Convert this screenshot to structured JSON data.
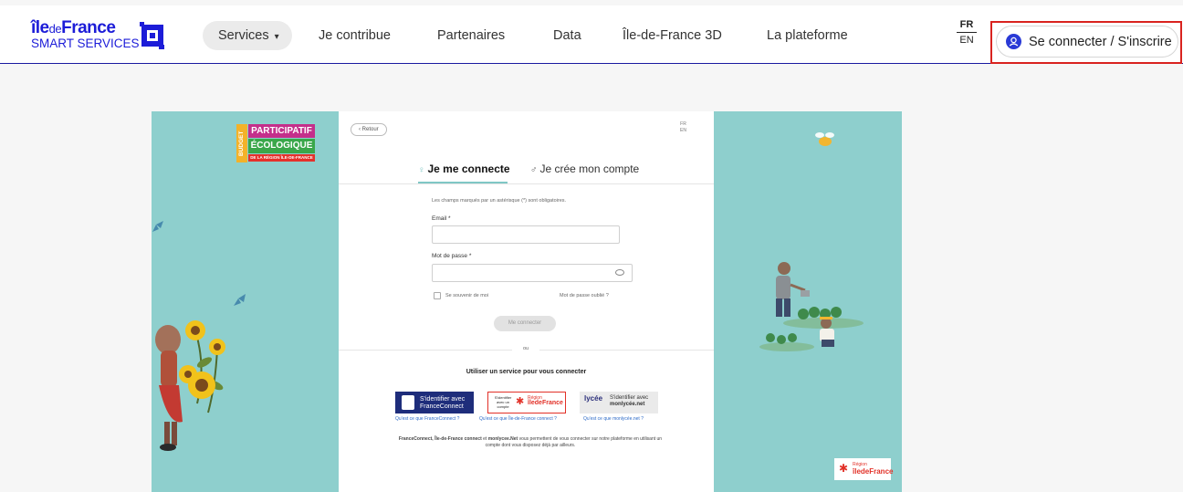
{
  "header": {
    "logo": {
      "line1_ile": "île",
      "line1_de": "de",
      "line1_france": "France",
      "line2": "SMART SERVICES"
    },
    "nav": [
      {
        "label": "Services",
        "active": true,
        "has_dropdown": true
      },
      {
        "label": "Je contribue"
      },
      {
        "label": "Partenaires"
      },
      {
        "label": "Data"
      },
      {
        "label": "Île-de-France 3D"
      },
      {
        "label": "La plateforme"
      }
    ],
    "dropdown_caret": "▾",
    "lang": {
      "current": "FR",
      "other": "EN"
    },
    "login_button": "Se connecter / S'inscrire",
    "login_icon": "user-circle-icon",
    "highlight_color": "#d9231f"
  },
  "embedded": {
    "budget_logo": {
      "vertical": "BUDGET",
      "line1": "PARTICIPATIF",
      "line2": "ÉCOLOGIQUE",
      "line3": "DE LA RÉGION ÎLE-DE-FRANCE"
    },
    "back_button": "‹ Retour",
    "lang": {
      "current": "FR",
      "other": "EN"
    },
    "tabs": {
      "login": "Je me connecte",
      "signup": "Je crée mon compte"
    },
    "required_note": "Les champs marqués par un astérisque (*) sont obligatoires.",
    "email_label": "Email *",
    "password_label": "Mot de passe *",
    "remember_me": "Se souvenir de moi",
    "forgot_password": "Mot de passe oublié ?",
    "submit": "Me connecter",
    "separator": "ou",
    "services_title": "Utiliser un service pour vous connecter",
    "franceconnect": {
      "line1": "S'identifier avec",
      "line2": "FranceConnect",
      "help": "Qu'est ce que FranceConnect ?"
    },
    "idf_connect": {
      "left": "S'identifier avec un compte",
      "region": "Région",
      "brand": "îledeFrance",
      "help": "Qu'est ce que Île-de-France connect ?"
    },
    "monlycee": {
      "logo": "lycée",
      "line1": "S'identifier avec",
      "line2": "monlycée.net",
      "help": "Qu'est ce que monlycée.net ?"
    },
    "footer_note_bold1": "FranceConnect, Île-de-France connect",
    "footer_note_mid": " et ",
    "footer_note_bold2": "monlycee.Net",
    "footer_note_rest": " vous permettent de vous connecter sur notre plateforme en utilisant un compte dont vous disposez déjà par ailleurs.",
    "region_badge": {
      "line1": "Région",
      "line2": "îledeFrance"
    },
    "colors": {
      "panel_teal": "#8ecfcd",
      "accent_red": "#e23128",
      "fc_blue": "#1e2d7b"
    }
  }
}
